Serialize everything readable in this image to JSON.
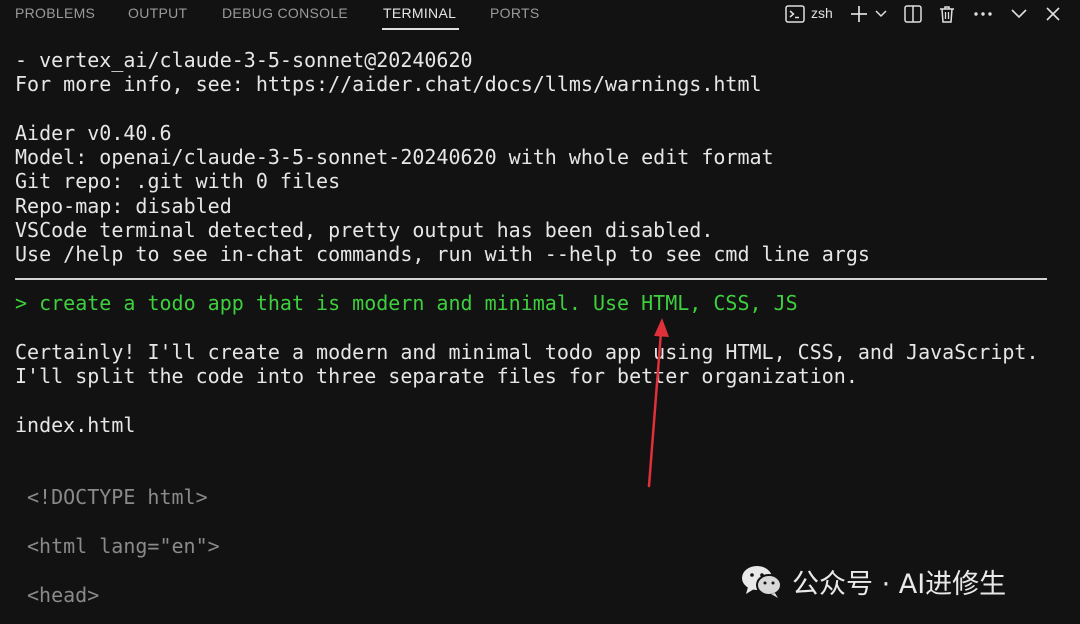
{
  "panel": {
    "tabs": [
      "PROBLEMS",
      "OUTPUT",
      "DEBUG CONSOLE",
      "TERMINAL",
      "PORTS"
    ],
    "active_tab": "TERMINAL",
    "shell_name": "zsh"
  },
  "terminal": {
    "lines": [
      "- vertex_ai/claude-3-5-sonnet@20240620",
      "For more info, see: https://aider.chat/docs/llms/warnings.html",
      "",
      "Aider v0.40.6",
      "Model: openai/claude-3-5-sonnet-20240620 with whole edit format",
      "Git repo: .git with 0 files",
      "Repo-map: disabled",
      "VSCode terminal detected, pretty output has been disabled.",
      "Use /help to see in-chat commands, run with --help to see cmd line args"
    ],
    "prompt": "> create a todo app that is modern and minimal. Use HTML, CSS, JS",
    "response": [
      "Certainly! I'll create a modern and minimal todo app using HTML, CSS, and JavaScript.",
      "I'll split the code into three separate files for better organization."
    ],
    "filename": "index.html",
    "code_lines": [
      "<!DOCTYPE html>",
      "<html lang=\"en\">",
      "<head>"
    ]
  },
  "watermark": {
    "text": "公众号 · AI进修生"
  },
  "colors": {
    "background": "#121212",
    "prompt_green": "#3ecf3e",
    "arrow_red": "#e0303a"
  }
}
